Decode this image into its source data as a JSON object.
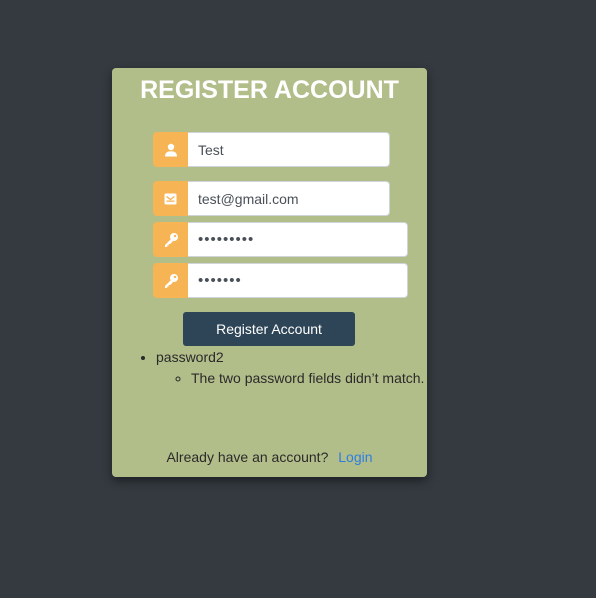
{
  "form": {
    "title": "REGISTER ACCOUNT",
    "username": {
      "value": "Test",
      "icon": "user-icon"
    },
    "email": {
      "value": "test@gmail.com",
      "icon": "envelope-icon"
    },
    "password1": {
      "value": "•••••••••",
      "icon": "key-icon"
    },
    "password2": {
      "value": "•••••••",
      "icon": "key-icon"
    },
    "submit_label": "Register Account"
  },
  "errors": [
    {
      "field": "password2",
      "messages": [
        "The two password fields didn’t match."
      ]
    }
  ],
  "footer": {
    "text": "Already have an account?",
    "link_label": "Login"
  },
  "colors": {
    "background": "#343a40",
    "card": "#b1be8a",
    "icon_accent": "#f6b454",
    "button": "#2e4557",
    "link": "#2f7de1"
  }
}
